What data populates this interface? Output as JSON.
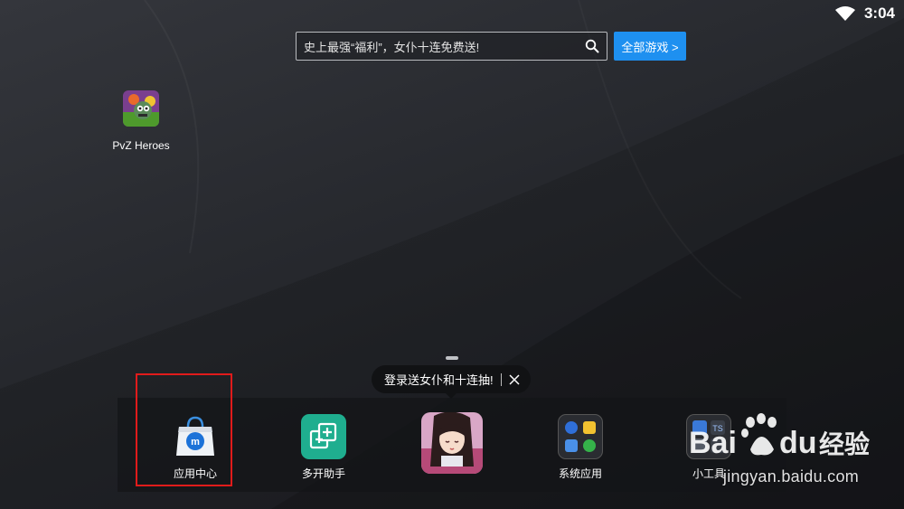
{
  "status_bar": {
    "time": "3:04",
    "wifi_icon": "wifi-icon"
  },
  "search": {
    "placeholder": "史上最强“福利”，女仆十连免费送!",
    "icon": "search-icon"
  },
  "all_games_button": {
    "label": "全部游戏 >"
  },
  "desktop_apps": [
    {
      "label": "PvZ Heroes",
      "icon": "pvz-heroes-icon"
    }
  ],
  "tooltip": {
    "text": "登录送女仆和十连抽!",
    "close_icon": "close-icon"
  },
  "dock": {
    "items": [
      {
        "label": "应用中心",
        "icon": "app-center-icon"
      },
      {
        "label": "多开助手",
        "icon": "multi-instance-icon"
      },
      {
        "label": "",
        "icon": "anime-game-icon"
      },
      {
        "label": "系统应用",
        "icon": "system-apps-icon"
      },
      {
        "label": "小工具",
        "icon": "tools-icon"
      }
    ]
  },
  "watermark": {
    "brand": "Baidu经验",
    "url": "jingyan.baidu.com"
  },
  "colors": {
    "accent": "#1e90f0",
    "highlight": "#e01b1b"
  }
}
